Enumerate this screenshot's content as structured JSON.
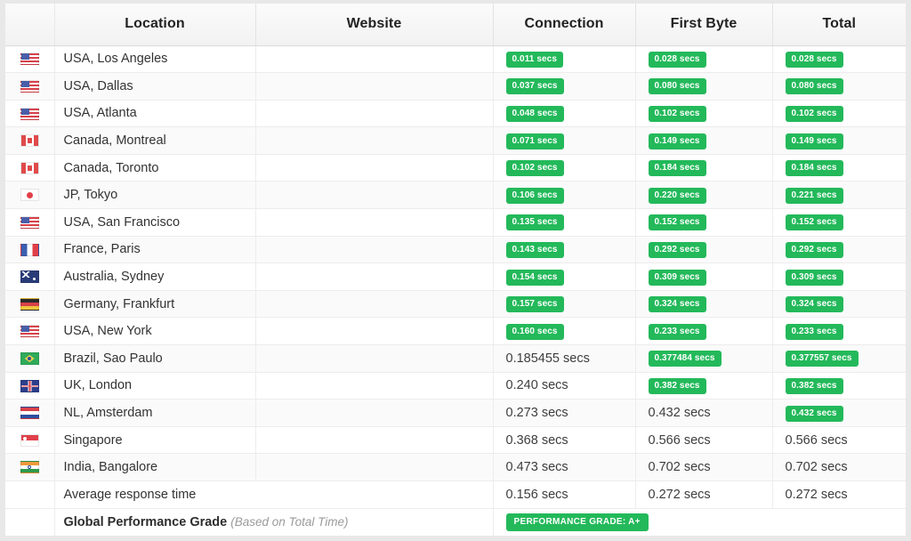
{
  "table": {
    "headers": {
      "flag": "",
      "location": "Location",
      "website": "Website",
      "connection": "Connection",
      "first_byte": "First Byte",
      "total": "Total"
    },
    "colors": {
      "badge_green": "#23b95a",
      "header_bg": "#f4f4f4",
      "row_alt_bg": "#fafafa",
      "page_bg": "#e8e8e8"
    },
    "rows": [
      {
        "flag": "flag-us",
        "location": "USA, Los Angeles",
        "website": "",
        "connection": "0.011 secs",
        "connection_badge": true,
        "first_byte": "0.028 secs",
        "first_byte_badge": true,
        "total": "0.028 secs",
        "total_badge": true
      },
      {
        "flag": "flag-us",
        "location": "USA, Dallas",
        "website": "",
        "connection": "0.037 secs",
        "connection_badge": true,
        "first_byte": "0.080 secs",
        "first_byte_badge": true,
        "total": "0.080 secs",
        "total_badge": true
      },
      {
        "flag": "flag-us",
        "location": "USA, Atlanta",
        "website": "",
        "connection": "0.048 secs",
        "connection_badge": true,
        "first_byte": "0.102 secs",
        "first_byte_badge": true,
        "total": "0.102 secs",
        "total_badge": true
      },
      {
        "flag": "flag-ca",
        "location": "Canada, Montreal",
        "website": "",
        "connection": "0.071 secs",
        "connection_badge": true,
        "first_byte": "0.149 secs",
        "first_byte_badge": true,
        "total": "0.149 secs",
        "total_badge": true
      },
      {
        "flag": "flag-ca",
        "location": "Canada, Toronto",
        "website": "",
        "connection": "0.102 secs",
        "connection_badge": true,
        "first_byte": "0.184 secs",
        "first_byte_badge": true,
        "total": "0.184 secs",
        "total_badge": true
      },
      {
        "flag": "flag-jp",
        "location": "JP, Tokyo",
        "website": "",
        "connection": "0.106 secs",
        "connection_badge": true,
        "first_byte": "0.220 secs",
        "first_byte_badge": true,
        "total": "0.221 secs",
        "total_badge": true
      },
      {
        "flag": "flag-us",
        "location": "USA, San Francisco",
        "website": "",
        "connection": "0.135 secs",
        "connection_badge": true,
        "first_byte": "0.152 secs",
        "first_byte_badge": true,
        "total": "0.152 secs",
        "total_badge": true
      },
      {
        "flag": "flag-fr",
        "location": "France, Paris",
        "website": "",
        "connection": "0.143 secs",
        "connection_badge": true,
        "first_byte": "0.292 secs",
        "first_byte_badge": true,
        "total": "0.292 secs",
        "total_badge": true
      },
      {
        "flag": "flag-au",
        "location": "Australia, Sydney",
        "website": "",
        "connection": "0.154 secs",
        "connection_badge": true,
        "first_byte": "0.309 secs",
        "first_byte_badge": true,
        "total": "0.309 secs",
        "total_badge": true
      },
      {
        "flag": "flag-de",
        "location": "Germany, Frankfurt",
        "website": "",
        "connection": "0.157 secs",
        "connection_badge": true,
        "first_byte": "0.324 secs",
        "first_byte_badge": true,
        "total": "0.324 secs",
        "total_badge": true
      },
      {
        "flag": "flag-us",
        "location": "USA, New York",
        "website": "",
        "connection": "0.160 secs",
        "connection_badge": true,
        "first_byte": "0.233 secs",
        "first_byte_badge": true,
        "total": "0.233 secs",
        "total_badge": true
      },
      {
        "flag": "flag-br",
        "location": "Brazil, Sao Paulo",
        "website": "",
        "connection": "0.185455 secs",
        "connection_badge": false,
        "first_byte": "0.377484 secs",
        "first_byte_badge": true,
        "total": "0.377557 secs",
        "total_badge": true
      },
      {
        "flag": "flag-uk",
        "location": "UK, London",
        "website": "",
        "connection": "0.240 secs",
        "connection_badge": false,
        "first_byte": "0.382 secs",
        "first_byte_badge": true,
        "total": "0.382 secs",
        "total_badge": true
      },
      {
        "flag": "flag-nl",
        "location": "NL, Amsterdam",
        "website": "",
        "connection": "0.273 secs",
        "connection_badge": false,
        "first_byte": "0.432 secs",
        "first_byte_badge": false,
        "total": "0.432 secs",
        "total_badge": true
      },
      {
        "flag": "flag-sg",
        "location": "Singapore",
        "website": "",
        "connection": "0.368 secs",
        "connection_badge": false,
        "first_byte": "0.566 secs",
        "first_byte_badge": false,
        "total": "0.566 secs",
        "total_badge": false
      },
      {
        "flag": "flag-in",
        "location": "India, Bangalore",
        "website": "",
        "connection": "0.473 secs",
        "connection_badge": false,
        "first_byte": "0.702 secs",
        "first_byte_badge": false,
        "total": "0.702 secs",
        "total_badge": false
      }
    ],
    "summary": {
      "average_label": "Average response time",
      "average_connection": "0.156 secs",
      "average_first_byte": "0.272 secs",
      "average_total": "0.272 secs",
      "grade_label": "Global Performance Grade",
      "grade_note": "(Based on Total Time)",
      "grade_badge": "PERFORMANCE GRADE:  A+"
    }
  }
}
